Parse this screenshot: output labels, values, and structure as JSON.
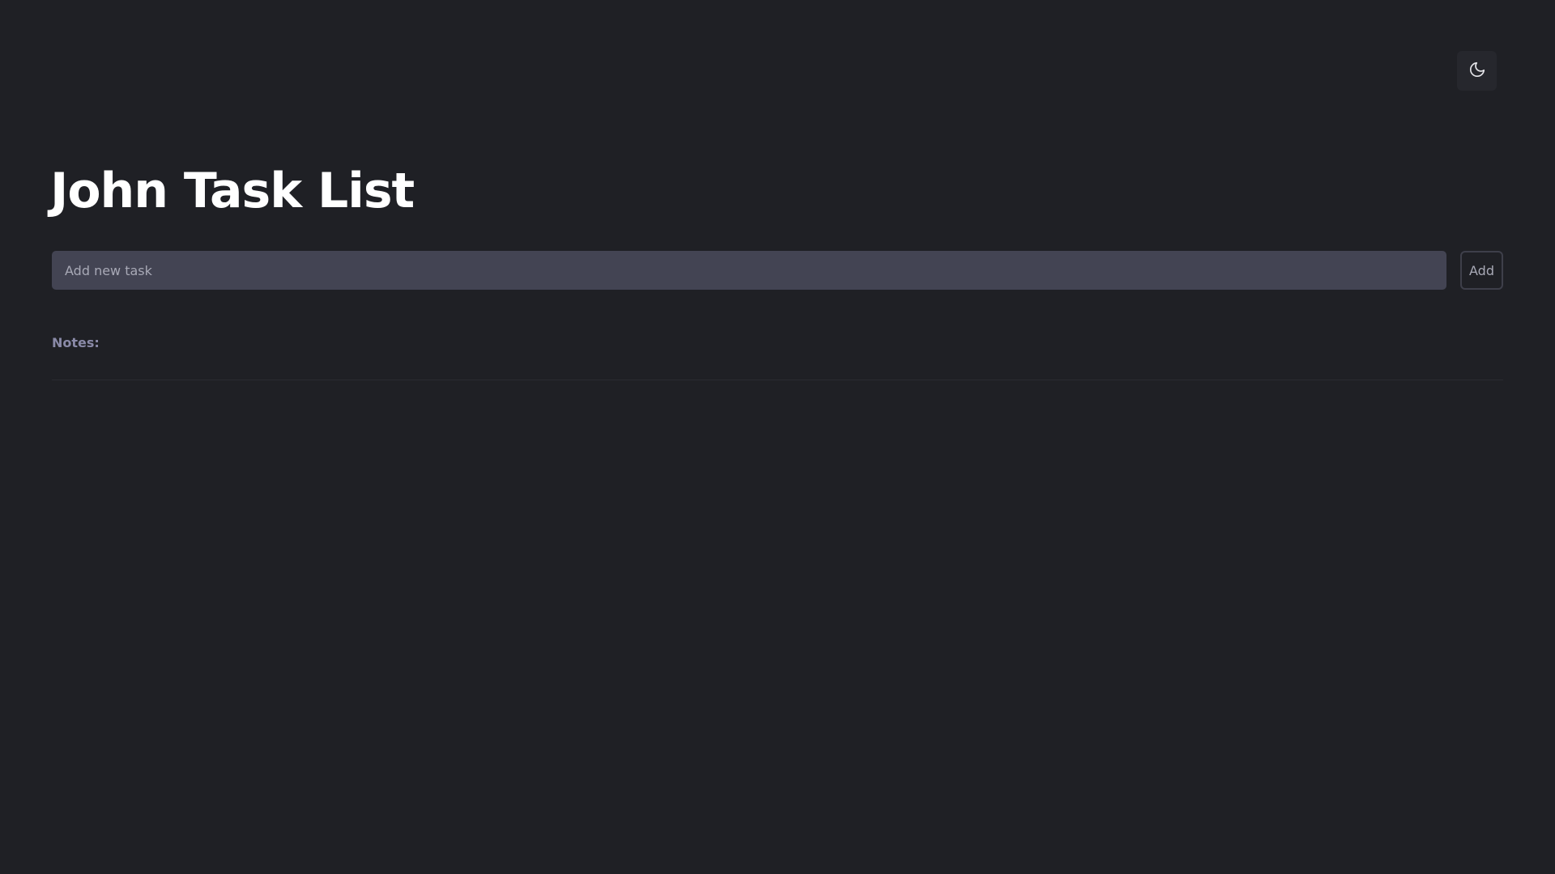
{
  "header": {
    "theme_toggle_icon": "moon-icon"
  },
  "main": {
    "title": "John Task List",
    "task_input": {
      "placeholder": "Add new task",
      "value": ""
    },
    "add_button_label": "Add",
    "notes_label": "Notes:"
  },
  "colors": {
    "background": "#1f2025",
    "input_background": "#434453",
    "notes_label": "#8a8aa8"
  }
}
